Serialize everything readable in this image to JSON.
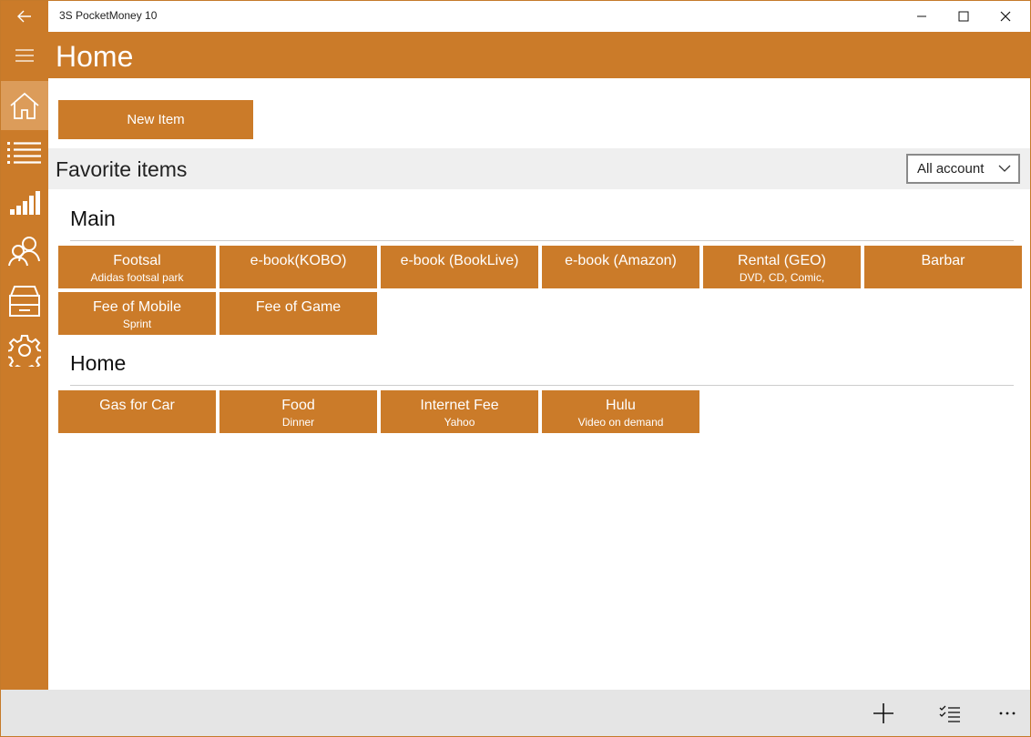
{
  "window": {
    "title": "3S PocketMoney 10"
  },
  "header": {
    "page_title": "Home"
  },
  "sidebar": {
    "items": [
      {
        "icon": "home-icon",
        "active": true
      },
      {
        "icon": "list-icon",
        "active": false
      },
      {
        "icon": "chart-icon",
        "active": false
      },
      {
        "icon": "people-icon",
        "active": false
      },
      {
        "icon": "bank-icon",
        "active": false
      },
      {
        "icon": "gear-icon",
        "active": false
      }
    ]
  },
  "main": {
    "new_item_label": "New Item",
    "favorites_title": "Favorite items",
    "account_select": {
      "value": "All account"
    },
    "groups": [
      {
        "title": "Main",
        "tiles": [
          {
            "label": "Footsal",
            "sub": "Adidas footsal park"
          },
          {
            "label": "e-book(KOBO)",
            "sub": ""
          },
          {
            "label": "e-book (BookLive)",
            "sub": ""
          },
          {
            "label": "e-book (Amazon)",
            "sub": ""
          },
          {
            "label": "Rental (GEO)",
            "sub": "DVD, CD, Comic,"
          },
          {
            "label": "Barbar",
            "sub": ""
          },
          {
            "label": "Fee of Mobile",
            "sub": "Sprint"
          },
          {
            "label": "Fee of Game",
            "sub": ""
          }
        ]
      },
      {
        "title": "Home",
        "tiles": [
          {
            "label": "Gas for Car",
            "sub": ""
          },
          {
            "label": "Food",
            "sub": "Dinner"
          },
          {
            "label": "Internet Fee",
            "sub": "Yahoo"
          },
          {
            "label": "Hulu",
            "sub": "Video on demand"
          }
        ]
      }
    ]
  },
  "bottombar": {
    "buttons": [
      "add-icon",
      "checklist-icon",
      "more-icon"
    ]
  },
  "colors": {
    "accent": "#cb7b29",
    "accent_light": "#dc9c5a",
    "bottom_bar": "#e5e5e5",
    "fav_bar": "#efefef"
  }
}
